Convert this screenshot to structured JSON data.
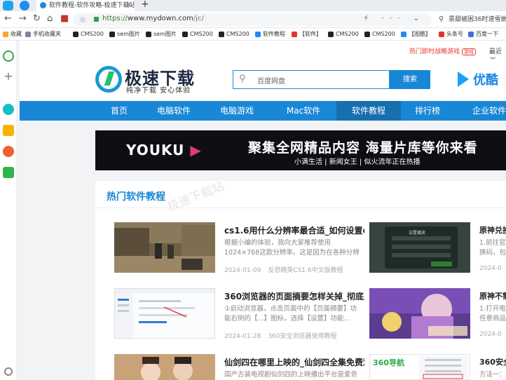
{
  "browser": {
    "tab_title": "软件教程-软件攻略-极速下载站",
    "url_prefix": "https://",
    "url_host": "www.mydown.com",
    "url_path": "/jc/",
    "search_text": "景甜被困36时速雪崩",
    "page_icons": "⚡ ··· ⌄"
  },
  "bookmarks": [
    {
      "label": "收藏",
      "color": "#f5a623"
    },
    {
      "label": "手机收藏夹",
      "color": "#7a8899"
    },
    {
      "label": "CMS200",
      "color": "#222222"
    },
    {
      "label": "sem图片",
      "color": "#222222"
    },
    {
      "label": "sem图片",
      "color": "#222222"
    },
    {
      "label": "CMS200",
      "color": "#222222"
    },
    {
      "label": "CMS200",
      "color": "#222222"
    },
    {
      "label": "软件教程",
      "color": "#1c8df2"
    },
    {
      "label": "【软件】",
      "color": "#e0332b"
    },
    {
      "label": "CMS200",
      "color": "#222222"
    },
    {
      "label": "CMS200",
      "color": "#222222"
    },
    {
      "label": "【图酷】",
      "color": "#1c8df2"
    },
    {
      "label": "头条号",
      "color": "#e03131"
    },
    {
      "label": "百度一下",
      "color": "#3b6fd8"
    }
  ],
  "notice": {
    "hot_text": "热门即时战略游戏",
    "hot_badge": "游戏",
    "recent": "最近浏"
  },
  "site": {
    "logo_title": "极速下载",
    "logo_sub": "纯净下载 安心体验",
    "search_placeholder": "百度网盘",
    "search_button": "搜索",
    "ad_brand": "优酷"
  },
  "nav": {
    "items": [
      "首页",
      "电脑软件",
      "电脑游戏",
      "Mac软件",
      "软件教程",
      "排行榜",
      "企业软件"
    ],
    "active": "软件教程"
  },
  "banner": {
    "brand_left": "YOUKU",
    "brand_arrow": "▶",
    "headline": "聚集全网精品内容 海量片库等你来看",
    "sub": "小满生活 | 新闻女王 | 似火流年正在热播"
  },
  "section": {
    "title": "热门软件教程",
    "watermark": "极速下载站"
  },
  "articles_left": [
    {
      "title": "cs1.6用什么分辨率最合适_如何设置cs1...",
      "desc": "根据小编的体验，我向大家推荐使用1024×768这款分辨率。这是因为在各种分辨率...",
      "date": "2024-01-09",
      "tag": "反恐精英CS1.6中文版教程"
    },
    {
      "title": "360浏览器的页面摘要怎样关掉_彻底关...",
      "desc": "①启动浏览器，点击页面中的【页面摘要】功能右侧的【...】图标，选择【设置】功能...",
      "date": "2024-01-28",
      "tag": "360安全浏览器使用教程"
    },
    {
      "title": "仙剑四在哪里上映的_仙剑四全集免费观...",
      "desc": "国产古装电视剧仙剑四的上映播出平台是爱奇艺",
      "date": "",
      "tag": ""
    }
  ],
  "articles_right": [
    {
      "title": "原神兑换",
      "desc1": "1.前往官方",
      "desc2": "换码，包括",
      "date": "2024-0"
    },
    {
      "title": "原神不需",
      "desc1": "1.打开电脑",
      "desc2": "任意商品的",
      "date": "2024-0"
    },
    {
      "title": "360安全",
      "desc1": "方法一：",
      "desc2": "",
      "date": ""
    }
  ],
  "thumb_texts": {
    "dialog_title": "设置播放",
    "logo_360": "360导航"
  }
}
